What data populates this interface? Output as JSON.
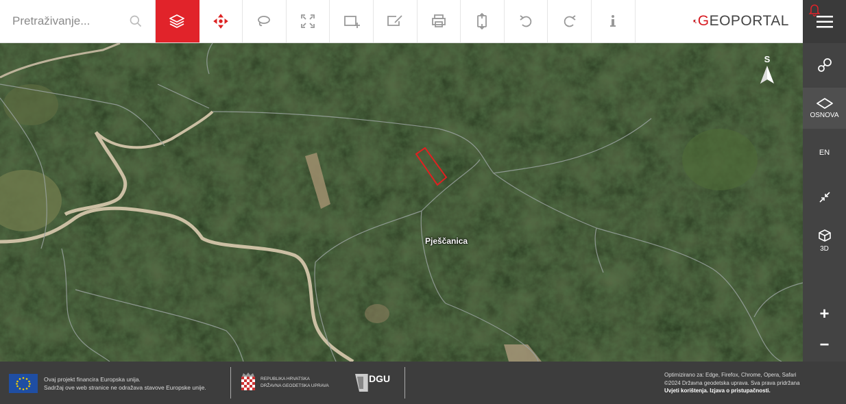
{
  "search": {
    "placeholder": "Pretraživanje..."
  },
  "toolbar": {
    "tools": [
      {
        "name": "layers-icon",
        "active": true
      },
      {
        "name": "move-arrows-icon",
        "accent": true
      },
      {
        "name": "lasso-icon"
      },
      {
        "name": "fullscreen-icon"
      },
      {
        "name": "add-area-icon"
      },
      {
        "name": "edit-area-icon"
      },
      {
        "name": "print-icon"
      },
      {
        "name": "measure-icon"
      },
      {
        "name": "undo-icon"
      },
      {
        "name": "redo-icon"
      },
      {
        "name": "info-icon"
      }
    ]
  },
  "logo": {
    "prefix": "G",
    "text": "EOPORTAL"
  },
  "right_panel": {
    "compass_label": "S",
    "base_label": "OSNOVA",
    "lang_label": "EN",
    "view3d_label": "3D",
    "zoom_in": "+",
    "zoom_out": "−"
  },
  "map": {
    "place_name": "Pješčanica"
  },
  "footer": {
    "eu_line1": "Ovaj projekt financira Europska unija.",
    "eu_line2": "Sadržaj ove web stranice ne odražava stavove Europske unije.",
    "cro_line1": "REPUBLIKA HRVATSKA",
    "cro_line2": "DRŽAVNA GEODETSKA UPRAVA",
    "dgu_label": "DGU",
    "opt_line1": "Optimizirano za: Edge, Firefox, Chrome, Opera, Safari",
    "opt_line2": "©2024 Državna geodetska uprava. Sva prava pridržana",
    "terms_link": "Uvjeti korištenja.",
    "access_link": "Izjava o pristupačnosti."
  },
  "colors": {
    "accent": "#e1232a",
    "panel": "#434343",
    "footer": "#3d3d3d"
  }
}
